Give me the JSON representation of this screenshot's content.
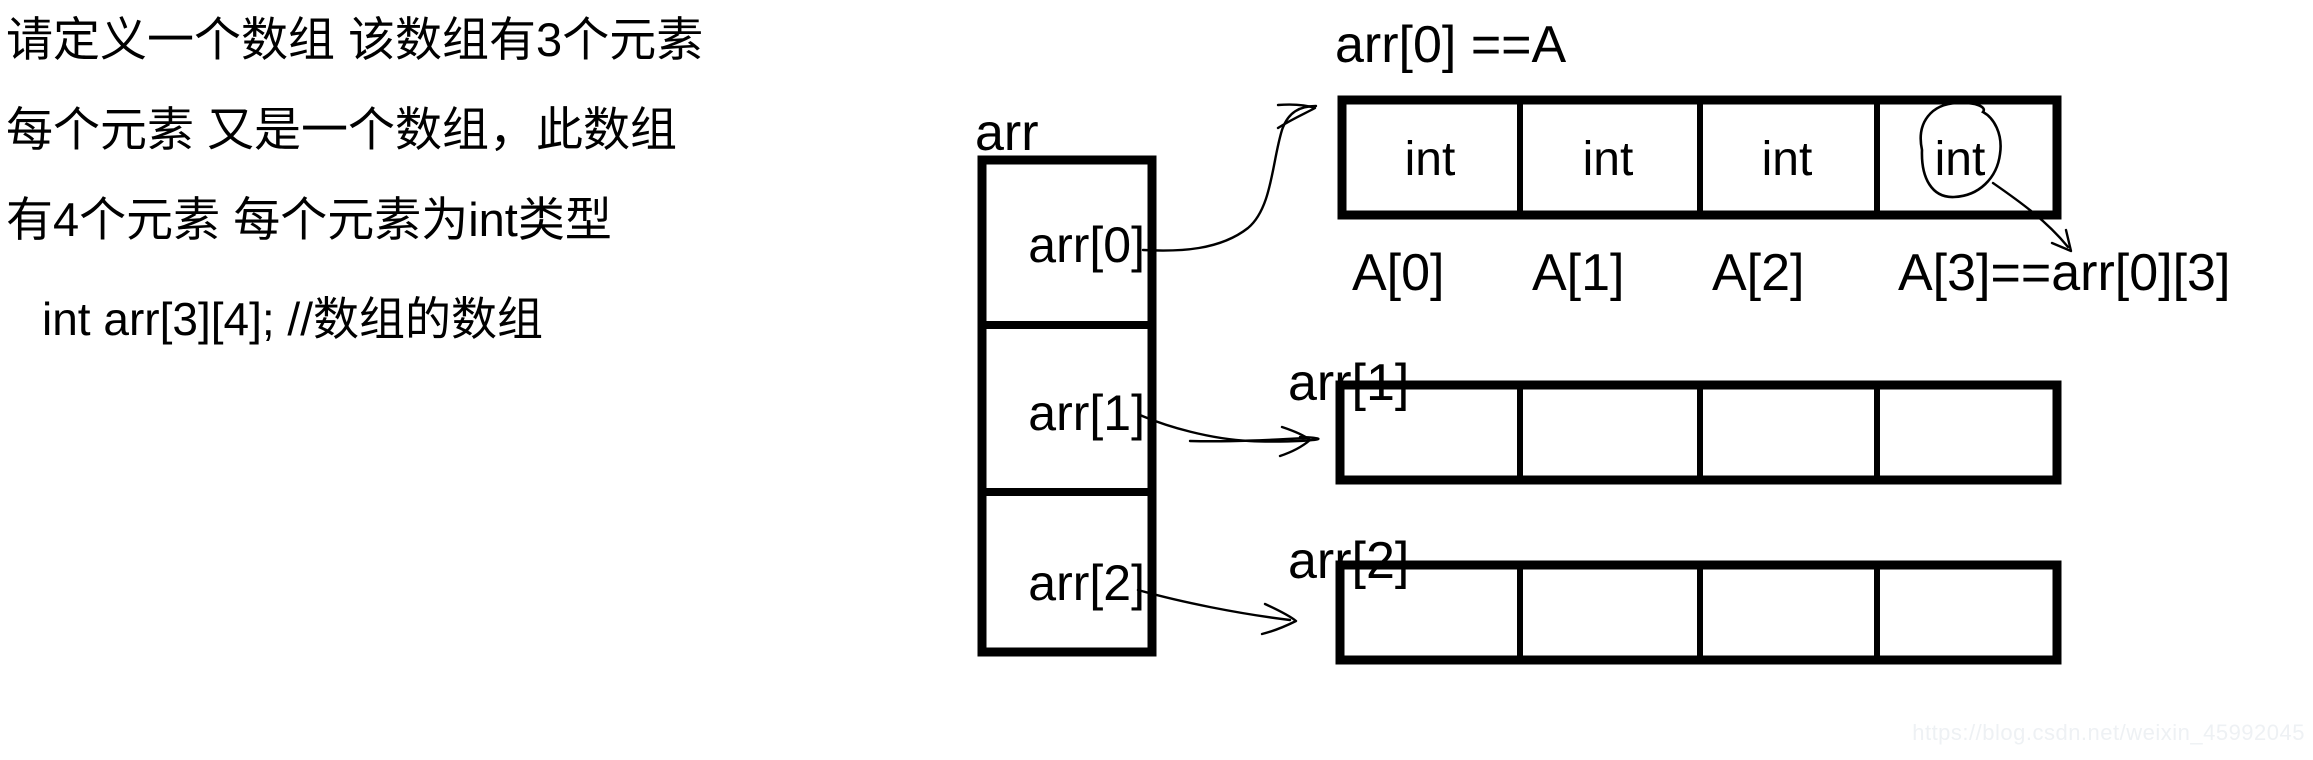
{
  "meta": {
    "title": "C 二维数组示意图 (array of arrays)"
  },
  "explanation": {
    "lines": [
      "请定义一个数组 该数组有3个元素",
      "每个元素 又是一个数组，此数组",
      "有4个元素 每个元素为int类型"
    ],
    "code": "int arr[3][4];   //数组的数组"
  },
  "arr_column": {
    "title": "arr",
    "cells": [
      {
        "label": "arr[0]"
      },
      {
        "label": "arr[1]"
      },
      {
        "label": "arr[2]"
      }
    ]
  },
  "rows": [
    {
      "id": "row0",
      "caption": "arr[0] ==A",
      "side_label": "",
      "cells": [
        "int",
        "int",
        "int",
        "int"
      ],
      "index_labels": [
        "A[0]",
        "A[1]",
        "A[2]",
        "A[3]==arr[0][3]"
      ],
      "highlight_cell_index": 3
    },
    {
      "id": "row1",
      "caption": "",
      "side_label": "arr[1]",
      "cells": [
        "",
        "",
        "",
        ""
      ],
      "index_labels": []
    },
    {
      "id": "row2",
      "caption": "",
      "side_label": "arr[2]",
      "cells": [
        "",
        "",
        "",
        ""
      ],
      "index_labels": []
    }
  ],
  "annotations": {
    "arrow_arr0_label": "arrow-arr0-to-row0",
    "arrow_arr1_label": "arrow-arr1-to-row1",
    "arrow_arr2_label": "arrow-arr2-to-row2",
    "circle_label": "circle-around-last-int",
    "pointer_label": "pointer-last-int-to-A3"
  },
  "watermark": {
    "text": "https://blog.csdn.net/weixin_45992045"
  },
  "colors": {
    "ink": "#000000",
    "paper": "#ffffff",
    "watermark": "#eef1f4"
  }
}
